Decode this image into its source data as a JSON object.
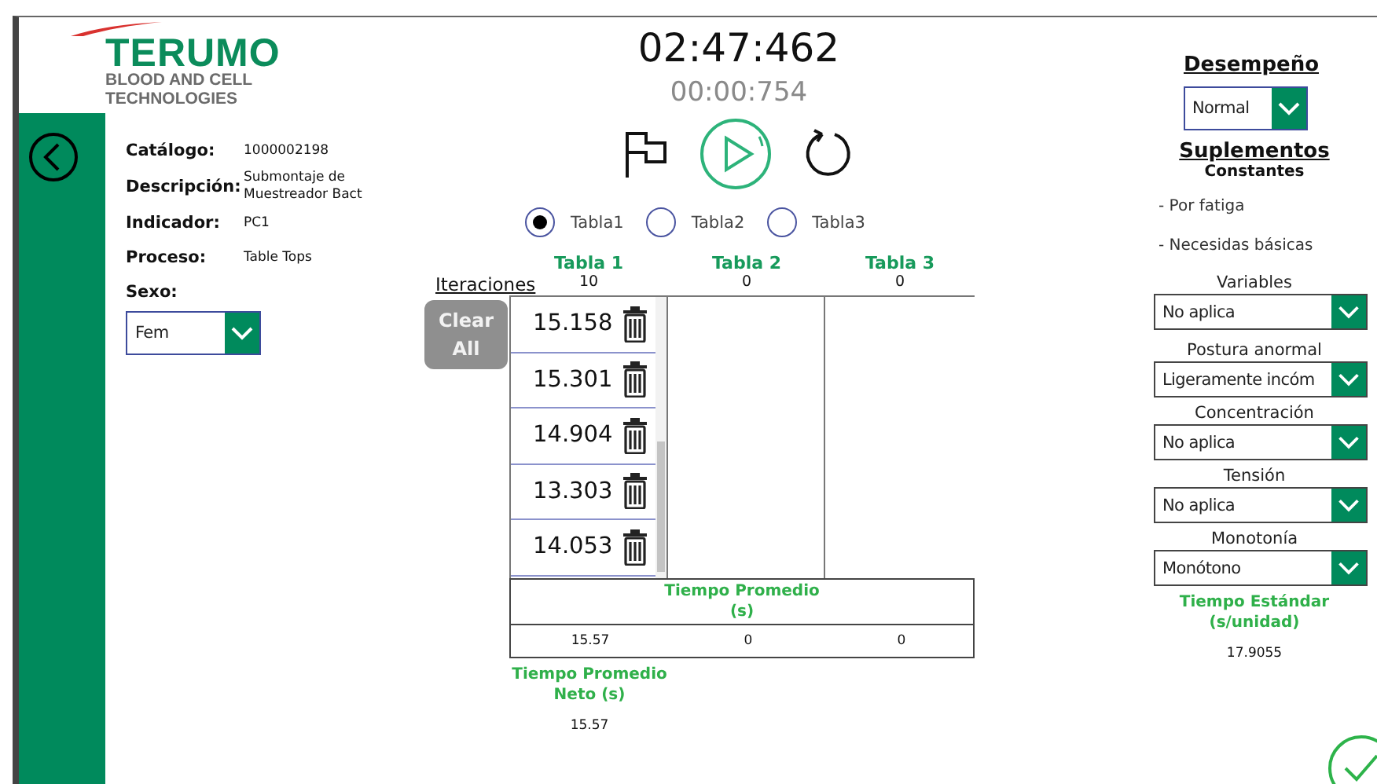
{
  "logo": {
    "brand": "TERUMO",
    "tagline_1": "BLOOD AND CELL",
    "tagline_2": "TECHNOLOGIES"
  },
  "info": [
    {
      "label": "Catálogo:",
      "value": "1000002198"
    },
    {
      "label": "Descripción:",
      "value": "Submontaje de Muestreador Bact"
    },
    {
      "label": "Indicador:",
      "value": "PC1"
    },
    {
      "label": "Proceso:",
      "value": "Table Tops"
    }
  ],
  "sexo": {
    "label": "Sexo:",
    "value": "Fem"
  },
  "timer": {
    "main": "02:47:462",
    "lap": "00:00:754"
  },
  "table_options": [
    {
      "label": "Tabla1",
      "selected": true
    },
    {
      "label": "Tabla2",
      "selected": false
    },
    {
      "label": "Tabla3",
      "selected": false
    }
  ],
  "table": {
    "columns": [
      "Tabla 1",
      "Tabla 2",
      "Tabla 3"
    ],
    "iterations_label": "Iteraciones",
    "counts": [
      "10",
      "0",
      "0"
    ],
    "times": [
      "15.158",
      "15.301",
      "14.904",
      "13.303",
      "14.053"
    ],
    "average_label": "Tiempo Promedio (s)",
    "averages": [
      "15.57",
      "0",
      "0"
    ],
    "net_label": "Tiempo Promedio Neto (s)",
    "net_value": "15.57"
  },
  "clear_button": "Clear All",
  "desempeno": {
    "label": "Desempeño",
    "value": "Normal"
  },
  "suplementos": {
    "title": "Suplementos",
    "subtitle": "Constantes",
    "constantes": [
      "- Por fatiga",
      "- Necesidas básicas"
    ],
    "selects": [
      {
        "label": "Variables",
        "value": "No aplica"
      },
      {
        "label": "Postura anormal",
        "value": "Ligeramente incóm"
      },
      {
        "label": "Concentración",
        "value": "No aplica"
      },
      {
        "label": "Tensión",
        "value": "No aplica"
      },
      {
        "label": "Monotonía",
        "value": "Monótono"
      }
    ]
  },
  "standard": {
    "label": "Tiempo Estándar (s/unidad)",
    "value": "17.9055"
  }
}
